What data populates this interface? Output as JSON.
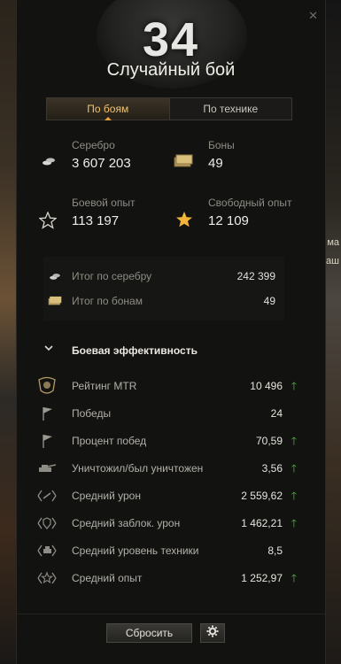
{
  "header": {
    "number": "34",
    "title": "Случайный бой"
  },
  "tabs": [
    {
      "label": "По боям",
      "active": true
    },
    {
      "label": "По технике",
      "active": false
    }
  ],
  "summary": {
    "silver": {
      "label": "Серебро",
      "value": "3 607 203"
    },
    "bonds": {
      "label": "Боны",
      "value": "49"
    },
    "battle_xp": {
      "label": "Боевой опыт",
      "value": "113 197"
    },
    "free_xp": {
      "label": "Свободный опыт",
      "value": "12 109"
    }
  },
  "totals": [
    {
      "label": "Итог по серебру",
      "value": "242 399",
      "icon": "silver-icon"
    },
    {
      "label": "Итог по бонам",
      "value": "49",
      "icon": "bonds-icon"
    }
  ],
  "efficiency": {
    "title": "Боевая эффективность",
    "rows": [
      {
        "label": "Рейтинг MTR",
        "value": "10 496",
        "trend": "up",
        "icon": "rating-badge-icon"
      },
      {
        "label": "Победы",
        "value": "24",
        "trend": "",
        "icon": "flag-icon"
      },
      {
        "label": "Процент побед",
        "value": "70,59",
        "trend": "up",
        "icon": "flag-icon"
      },
      {
        "label": "Уничтожил/был уничтожен",
        "value": "3,56",
        "trend": "up",
        "icon": "destroyed-ratio-icon"
      },
      {
        "label": "Средний урон",
        "value": "2 559,62",
        "trend": "up",
        "icon": "damage-icon"
      },
      {
        "label": "Средний заблок. урон",
        "value": "1 462,21",
        "trend": "up",
        "icon": "blocked-damage-icon"
      },
      {
        "label": "Средний уровень техники",
        "value": "8,5",
        "trend": "",
        "icon": "tier-icon"
      },
      {
        "label": "Средний опыт",
        "value": "1 252,97",
        "trend": "up",
        "icon": "xp-icon"
      }
    ]
  },
  "edge_text": {
    "right_1": "ма",
    "right_2": "ваш"
  },
  "footer": {
    "reset_label": "Сбросить"
  },
  "colors": {
    "accent": "#e8a23c",
    "trend_up": "#4fbf3a",
    "star": "#f2b53a"
  }
}
